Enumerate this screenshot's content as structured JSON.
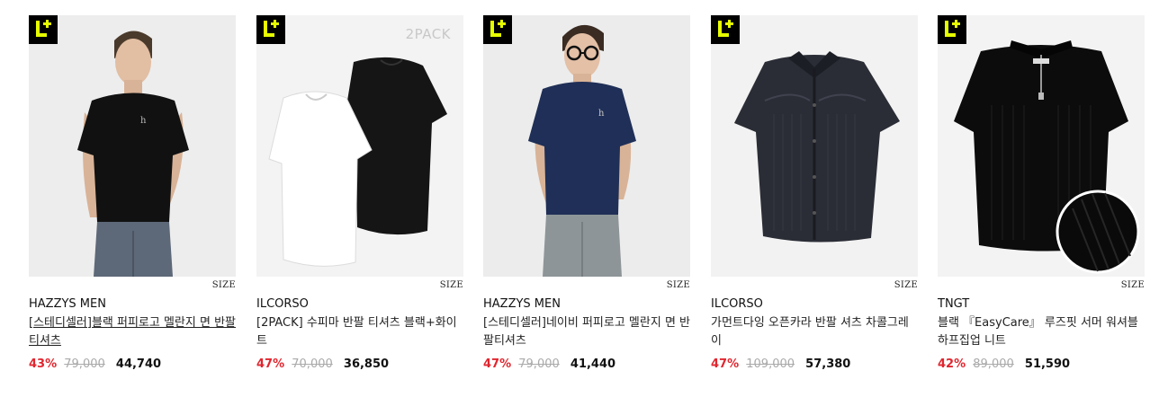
{
  "products": [
    {
      "brand": "HAZZYS MEN",
      "name": "[스테디셀러]블랙 퍼피로고 멜란지 면 반팔 티셔츠",
      "discount": "43%",
      "original_price": "79,000",
      "sale_price": "44,740",
      "size_label": "SIZE",
      "badge_icon": "l-plus-badge-icon",
      "shirt_color": "#111111"
    },
    {
      "brand": "ILCORSO",
      "name": "[2PACK] 수피마 반팔 티셔츠 블랙+화이트",
      "discount": "47%",
      "original_price": "70,000",
      "sale_price": "36,850",
      "size_label": "SIZE",
      "pack_label": "2PACK",
      "badge_icon": "l-plus-badge-icon"
    },
    {
      "brand": "HAZZYS MEN",
      "name": "[스테디셀러]네이비 퍼피로고 멜란지 면 반팔티셔츠",
      "discount": "47%",
      "original_price": "79,000",
      "sale_price": "41,440",
      "size_label": "SIZE",
      "badge_icon": "l-plus-badge-icon",
      "shirt_color": "#1f2f57"
    },
    {
      "brand": "ILCORSO",
      "name": "가먼트다잉 오픈카라 반팔 셔츠 차콜그레이",
      "discount": "47%",
      "original_price": "109,000",
      "sale_price": "57,380",
      "size_label": "SIZE",
      "badge_icon": "l-plus-badge-icon",
      "shirt_color": "#2b2d36"
    },
    {
      "brand": "TNGT",
      "name": "블랙 『EasyCare』 루즈핏 서머 워셔블 하프집업 니트",
      "discount": "42%",
      "original_price": "89,000",
      "sale_price": "51,590",
      "size_label": "SIZE",
      "badge_icon": "l-plus-badge-icon",
      "shirt_color": "#0c0c0c"
    }
  ],
  "colors": {
    "discount": "#e0262f",
    "badge_accent": "#e6ff00",
    "badge_bg": "#000000"
  }
}
